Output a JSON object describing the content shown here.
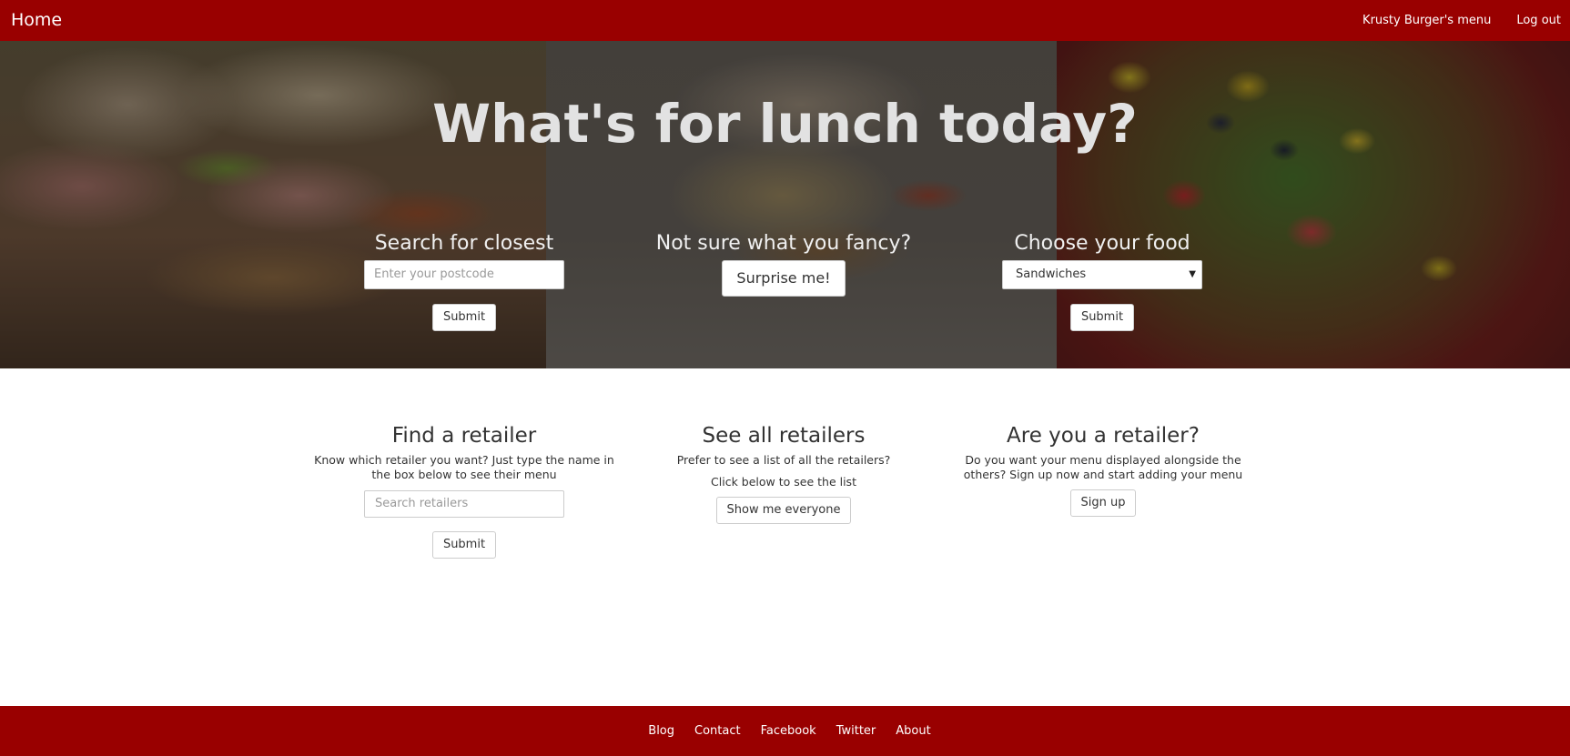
{
  "nav": {
    "brand": "Home",
    "links": [
      "Krusty Burger's menu",
      "Log out"
    ]
  },
  "hero": {
    "title": "What's for lunch today?",
    "search": {
      "heading": "Search for closest",
      "placeholder": "Enter your postcode",
      "submit": "Submit"
    },
    "surprise": {
      "heading": "Not sure what you fancy?",
      "button": "Surprise me!"
    },
    "choose": {
      "heading": "Choose your food",
      "selected": "Sandwiches",
      "submit": "Submit"
    }
  },
  "sections": {
    "find": {
      "heading": "Find a retailer",
      "text": "Know which retailer you want? Just type the name in the box below to see their menu",
      "placeholder": "Search retailers",
      "submit": "Submit"
    },
    "all": {
      "heading": "See all retailers",
      "text1": "Prefer to see a list of all the retailers?",
      "text2": "Click below to see the list",
      "button": "Show me everyone"
    },
    "retailer": {
      "heading": "Are you a retailer?",
      "text": "Do you want your menu displayed alongside the others? Sign up now and start adding your menu",
      "button": "Sign up"
    }
  },
  "footer": {
    "links": [
      "Blog",
      "Contact",
      "Facebook",
      "Twitter",
      "About"
    ]
  },
  "colors": {
    "brand_red": "#990000"
  }
}
